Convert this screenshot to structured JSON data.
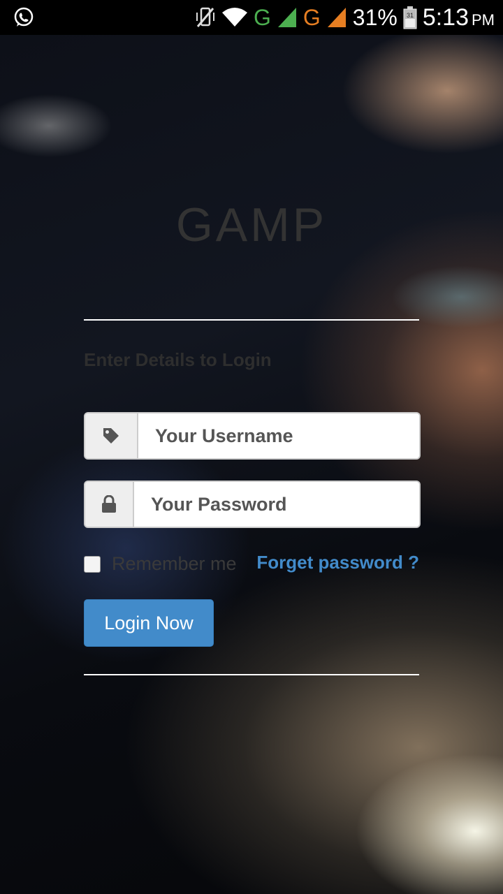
{
  "status_bar": {
    "icons": [
      "whatsapp-icon",
      "vibrate-mute-icon",
      "wifi-icon",
      "signal-icon",
      "signal-icon",
      "battery-icon"
    ],
    "network_type_1": "G",
    "network_type_2": "G",
    "battery_percent": "31%",
    "battery_level_label": "31",
    "time": "5:13",
    "time_suffix": "PM",
    "colors": {
      "network_1": "#4caf50",
      "network_2": "#e67e22"
    }
  },
  "login": {
    "app_title": "GAMP",
    "subtitle": "Enter Details to Login",
    "username_placeholder": "Your Username",
    "password_placeholder": "Your Password",
    "username_icon": "tag-icon",
    "password_icon": "lock-icon",
    "remember_label": "Remember me",
    "remember_checked": false,
    "forgot_link": "Forget password ?",
    "login_button": "Login Now"
  },
  "colors": {
    "accent": "#428bca",
    "title_text": "#333333",
    "divider": "#ffffff"
  }
}
